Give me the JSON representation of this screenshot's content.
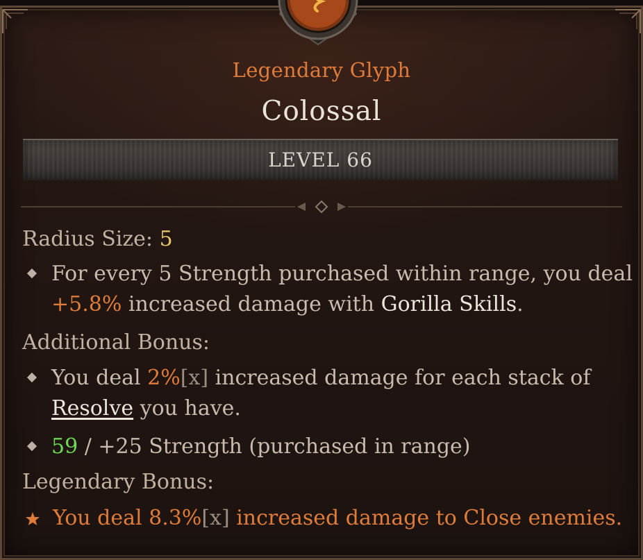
{
  "tooltip": {
    "type_line": "Legendary Glyph",
    "name": "Colossal",
    "level_label": "LEVEL 66",
    "radius_label": "Radius Size:",
    "radius_value": "5",
    "primary": {
      "line1": "For every 5 Strength purchased within range, you deal",
      "value": "+5.8%",
      "mid": "increased damage with",
      "skill": "Gorilla Skills",
      "end": "."
    },
    "additional_heading": "Additional Bonus:",
    "additional": {
      "pre": "You deal",
      "value": "2%",
      "mult": "[x]",
      "post": "increased damage for each stack of",
      "keyword": "Resolve",
      "end": "you have."
    },
    "requirement": {
      "current": "59",
      "sep": "/",
      "required": "+25 Strength (purchased in range)"
    },
    "legendary_heading": "Legendary Bonus:",
    "legendary": {
      "pre": "You deal",
      "value": "8.3%",
      "mult": "[x]",
      "post": "increased damage to Close enemies."
    }
  },
  "icons": {
    "emblem": "glyph-emblem-icon",
    "bullet": "diamond-bullet-icon",
    "star": "star-icon"
  },
  "colors": {
    "legendary": "#e07c3a",
    "value": "#e8c56a",
    "met": "#6fd957",
    "text": "#c9bcae"
  }
}
